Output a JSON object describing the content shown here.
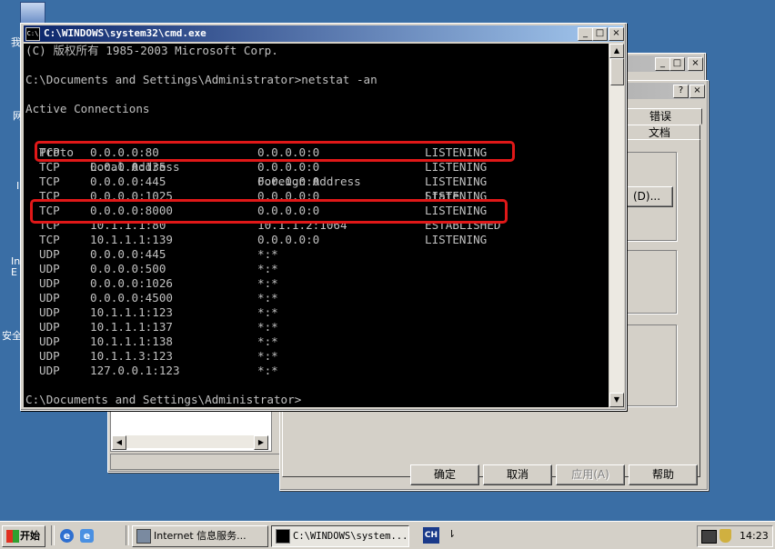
{
  "desktop": {
    "icon_labels": [
      "我",
      "网",
      "I",
      "In",
      "E",
      "安全"
    ]
  },
  "back_window": {
    "tabs": [
      "错误",
      "文档"
    ],
    "browse_button": "(D)...",
    "buttons": {
      "ok": "确定",
      "cancel": "取消",
      "apply": "应用(A)",
      "help": "帮助"
    }
  },
  "cmd": {
    "title": "C:\\WINDOWS\\system32\\cmd.exe",
    "copyright": "(C) 版权所有 1985-2003 Microsoft Corp.",
    "command_line": "C:\\Documents and Settings\\Administrator>netstat -an",
    "active_connections": "Active Connections",
    "headers": [
      "Proto",
      "Local Address",
      "Foreign Address",
      "State"
    ],
    "rows": [
      [
        "TCP",
        "0.0.0.0:80",
        "0.0.0.0:0",
        "LISTENING"
      ],
      [
        "TCP",
        "0.0.0.0:135",
        "0.0.0.0:0",
        "LISTENING"
      ],
      [
        "TCP",
        "0.0.0.0:445",
        "0.0.0.0:0",
        "LISTENING"
      ],
      [
        "TCP",
        "0.0.0.0:1025",
        "0.0.0.0:0",
        "LISTENING"
      ],
      [
        "TCP",
        "0.0.0.0:8000",
        "0.0.0.0:0",
        "LISTENING"
      ],
      [
        "TCP",
        "10.1.1.1:80",
        "10.1.1.2:1064",
        "ESTABLISHED"
      ],
      [
        "TCP",
        "10.1.1.1:139",
        "0.0.0.0:0",
        "LISTENING"
      ],
      [
        "UDP",
        "0.0.0.0:445",
        "*:*",
        ""
      ],
      [
        "UDP",
        "0.0.0.0:500",
        "*:*",
        ""
      ],
      [
        "UDP",
        "0.0.0.0:1026",
        "*:*",
        ""
      ],
      [
        "UDP",
        "0.0.0.0:4500",
        "*:*",
        ""
      ],
      [
        "UDP",
        "10.1.1.1:123",
        "*:*",
        ""
      ],
      [
        "UDP",
        "10.1.1.1:137",
        "*:*",
        ""
      ],
      [
        "UDP",
        "10.1.1.1:138",
        "*:*",
        ""
      ],
      [
        "UDP",
        "10.1.1.3:123",
        "*:*",
        ""
      ],
      [
        "UDP",
        "127.0.0.1:123",
        "*:*",
        ""
      ]
    ],
    "prompt": "C:\\Documents and Settings\\Administrator>",
    "highlight_color": "#e01818"
  },
  "taskbar": {
    "start": "开始",
    "tasks": [
      "Internet 信息服务...",
      "C:\\WINDOWS\\system..."
    ],
    "ime": "CH",
    "clock": "14:23"
  }
}
